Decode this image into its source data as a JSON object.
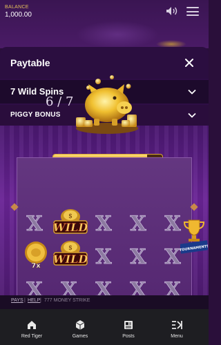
{
  "topbar": {
    "balance_label": "BALANCE",
    "balance_value": "1,000.00",
    "icons": [
      "speaker-icon",
      "hamburger-menu-icon"
    ]
  },
  "panel": {
    "title": "Paytable",
    "sections": [
      {
        "label": "7 Wild Spins",
        "expanded": true
      },
      {
        "label": "PIGGY BONUS",
        "expanded": true
      }
    ],
    "bonus": {
      "counter": "6 / 7",
      "progress": 0.86
    },
    "symbols": {
      "wild_label": "WILD",
      "multiplier": "7x",
      "tournaments_label": "TOURNAMENTS"
    }
  },
  "footer_links": {
    "pays": "PAYS",
    "help": "HELP",
    "game_name": "777 MONEY STRIKE"
  },
  "nav": [
    {
      "label": "Red Tiger",
      "icon": "home-icon"
    },
    {
      "label": "Games",
      "icon": "cube-icon"
    },
    {
      "label": "Posts",
      "icon": "newspaper-icon"
    },
    {
      "label": "Menu",
      "icon": "menu-icon"
    }
  ],
  "colors": {
    "accent_gold": "#e6c15a",
    "panel_bg": "#2e0e45",
    "nav_bg": "#1e1e22"
  }
}
